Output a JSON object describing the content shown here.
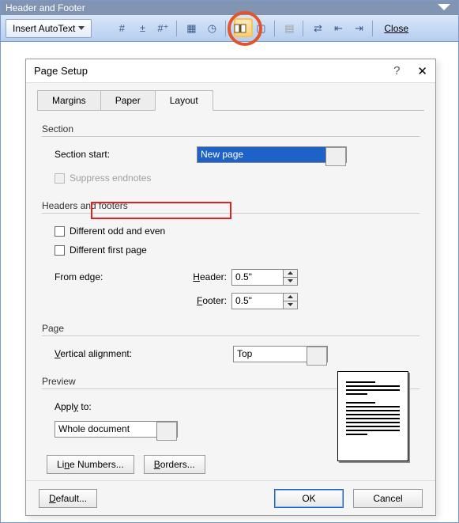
{
  "toolbar": {
    "title": "Header and Footer",
    "autotext_label": "Insert AutoText",
    "close_label": "Close"
  },
  "dialog": {
    "title": "Page Setup",
    "tabs": {
      "margins": "Margins",
      "paper": "Paper",
      "layout": "Layout"
    },
    "section": {
      "group": "Section",
      "start_label": "Section start:",
      "start_value": "New page",
      "suppress_label": "Suppress endnotes"
    },
    "hf": {
      "group": "Headers and footers",
      "odd_even": "Different odd and even",
      "first_page": "Different first page",
      "from_edge": "From edge:",
      "header_label": "Header:",
      "header_value": "0.5\"",
      "footer_label": "Footer:",
      "footer_value": "0.5\""
    },
    "page": {
      "group": "Page",
      "valign_label": "Vertical alignment:",
      "valign_value": "Top"
    },
    "preview": {
      "group": "Preview",
      "apply_label": "Apply to:",
      "apply_value": "Whole document"
    },
    "buttons": {
      "line_numbers": "Line Numbers...",
      "borders": "Borders...",
      "default": "Default...",
      "ok": "OK",
      "cancel": "Cancel"
    }
  }
}
